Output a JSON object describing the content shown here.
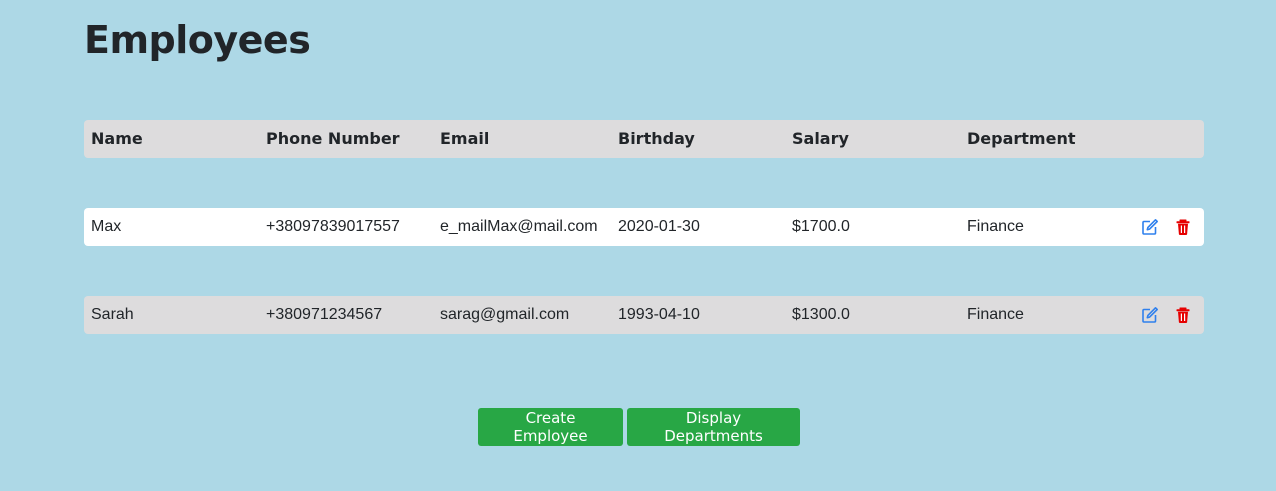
{
  "page": {
    "title": "Employees"
  },
  "table": {
    "headers": {
      "name": "Name",
      "phone": "Phone Number",
      "email": "Email",
      "birthday": "Birthday",
      "salary": "Salary",
      "department": "Department"
    },
    "rows": [
      {
        "name": "Max",
        "phone": "+38097839017557",
        "email": "e_mailMax@mail.com",
        "birthday": "2020-01-30",
        "salary": "$1700.0",
        "department": "Finance"
      },
      {
        "name": "Sarah",
        "phone": "+380971234567",
        "email": "sarag@gmail.com",
        "birthday": "1993-04-10",
        "salary": "$1300.0",
        "department": "Finance"
      }
    ],
    "row_icons": {
      "edit": "edit-icon",
      "delete": "trash-icon"
    }
  },
  "actions": {
    "create_label": "Create Employee",
    "display_label": "Display Departments"
  },
  "colors": {
    "background": "#add8e6",
    "header_row": "#dddcdd",
    "button": "#28a745",
    "edit_icon": "#2f80ed",
    "delete_icon": "#e60000"
  }
}
